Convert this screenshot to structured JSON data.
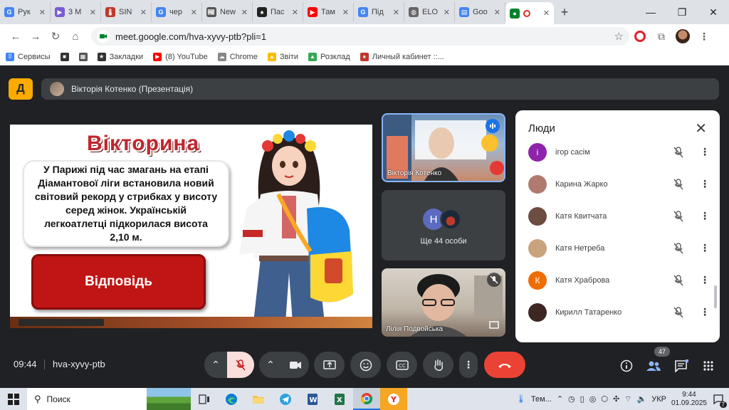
{
  "browser": {
    "tabs": [
      {
        "title": "Рук",
        "color": "#4285f4",
        "glyph": "G"
      },
      {
        "title": "3 М",
        "color": "#7b5cd6",
        "glyph": "▶"
      },
      {
        "title": "SIN",
        "color": "#c0392b",
        "glyph": "🌡"
      },
      {
        "title": "чер",
        "color": "#4285f4",
        "glyph": "G"
      },
      {
        "title": "New",
        "color": "#555555",
        "glyph": "📰"
      },
      {
        "title": "Пас",
        "color": "#222222",
        "glyph": "♠"
      },
      {
        "title": "Там",
        "color": "#ff0000",
        "glyph": "▶"
      },
      {
        "title": "Під",
        "color": "#4285f4",
        "glyph": "G"
      },
      {
        "title": "ELO",
        "color": "#666666",
        "glyph": "◍"
      },
      {
        "title": "Goo",
        "color": "#4285f4",
        "glyph": "▤"
      },
      {
        "title": "",
        "color": "#00832d",
        "glyph": "●",
        "active": true
      }
    ],
    "url": "meet.google.com/hva-xyvy-ptb?pli=1",
    "bookmarks": [
      {
        "label": "Сервисы",
        "color": "#4285f4",
        "glyph": "⠿"
      },
      {
        "label": "",
        "color": "#333333",
        "glyph": "■"
      },
      {
        "label": "",
        "color": "#555555",
        "glyph": "▦"
      },
      {
        "label": "Закладки",
        "color": "#333333",
        "glyph": "★"
      },
      {
        "label": "(8) YouTube",
        "color": "#ff0000",
        "glyph": "▶"
      },
      {
        "label": "Chrome",
        "color": "#888888",
        "glyph": "☁"
      },
      {
        "label": "Звіти",
        "color": "#fbbc04",
        "glyph": "▲"
      },
      {
        "label": "Розклад",
        "color": "#34a853",
        "glyph": "▲"
      },
      {
        "label": "Личный кабинет ::...",
        "color": "#c0392b",
        "glyph": "●"
      }
    ]
  },
  "meet": {
    "presenter_bar": "Вікторія Котенко (Презентація)",
    "slide": {
      "title": "Вікторина",
      "question": "У Парижі під час змагань на етапі Діамантової ліги встановила новий світовий рекорд у стрибках у висоту серед жінок. Українській легкоатлетці підкорилася висота 2,10 м.",
      "answer_button": "Відповідь"
    },
    "tiles": {
      "presenter_name": "Вікторія Котенко",
      "more_avatar_letter": "Н",
      "more_label": "Ще 44 особи",
      "third_name": "Лілія Подвойська"
    },
    "people_panel": {
      "title": "Люди",
      "participants": [
        {
          "name": "ігор сасім",
          "avatar_letter": "і",
          "avatar_color": "#8e24aa"
        },
        {
          "name": "Карина Жарко",
          "avatar_letter": "",
          "avatar_color": "#b07a70"
        },
        {
          "name": "Катя Квитчата",
          "avatar_letter": "",
          "avatar_color": "#6d4c41"
        },
        {
          "name": "Катя Нетреба",
          "avatar_letter": "",
          "avatar_color": "#c9a27e"
        },
        {
          "name": "Катя Храброва",
          "avatar_letter": "К",
          "avatar_color": "#ef6c00"
        },
        {
          "name": "Кирилл Татаренко",
          "avatar_letter": "",
          "avatar_color": "#3e2723"
        }
      ]
    },
    "controls": {
      "time": "09:44",
      "meeting_code": "hva-xyvy-ptb",
      "participant_count": "47"
    }
  },
  "taskbar": {
    "search_placeholder": "Поиск",
    "weather": "Тем...",
    "language": "УКР",
    "clock_time": "9:44",
    "clock_date": "01.09.2025",
    "notification_count": "7"
  },
  "colors": {
    "meet_bg": "#202124",
    "accent_blue": "#8ab4f8",
    "end_call_red": "#ea4335",
    "answer_red": "#c01515",
    "title_red": "#c0262d"
  }
}
